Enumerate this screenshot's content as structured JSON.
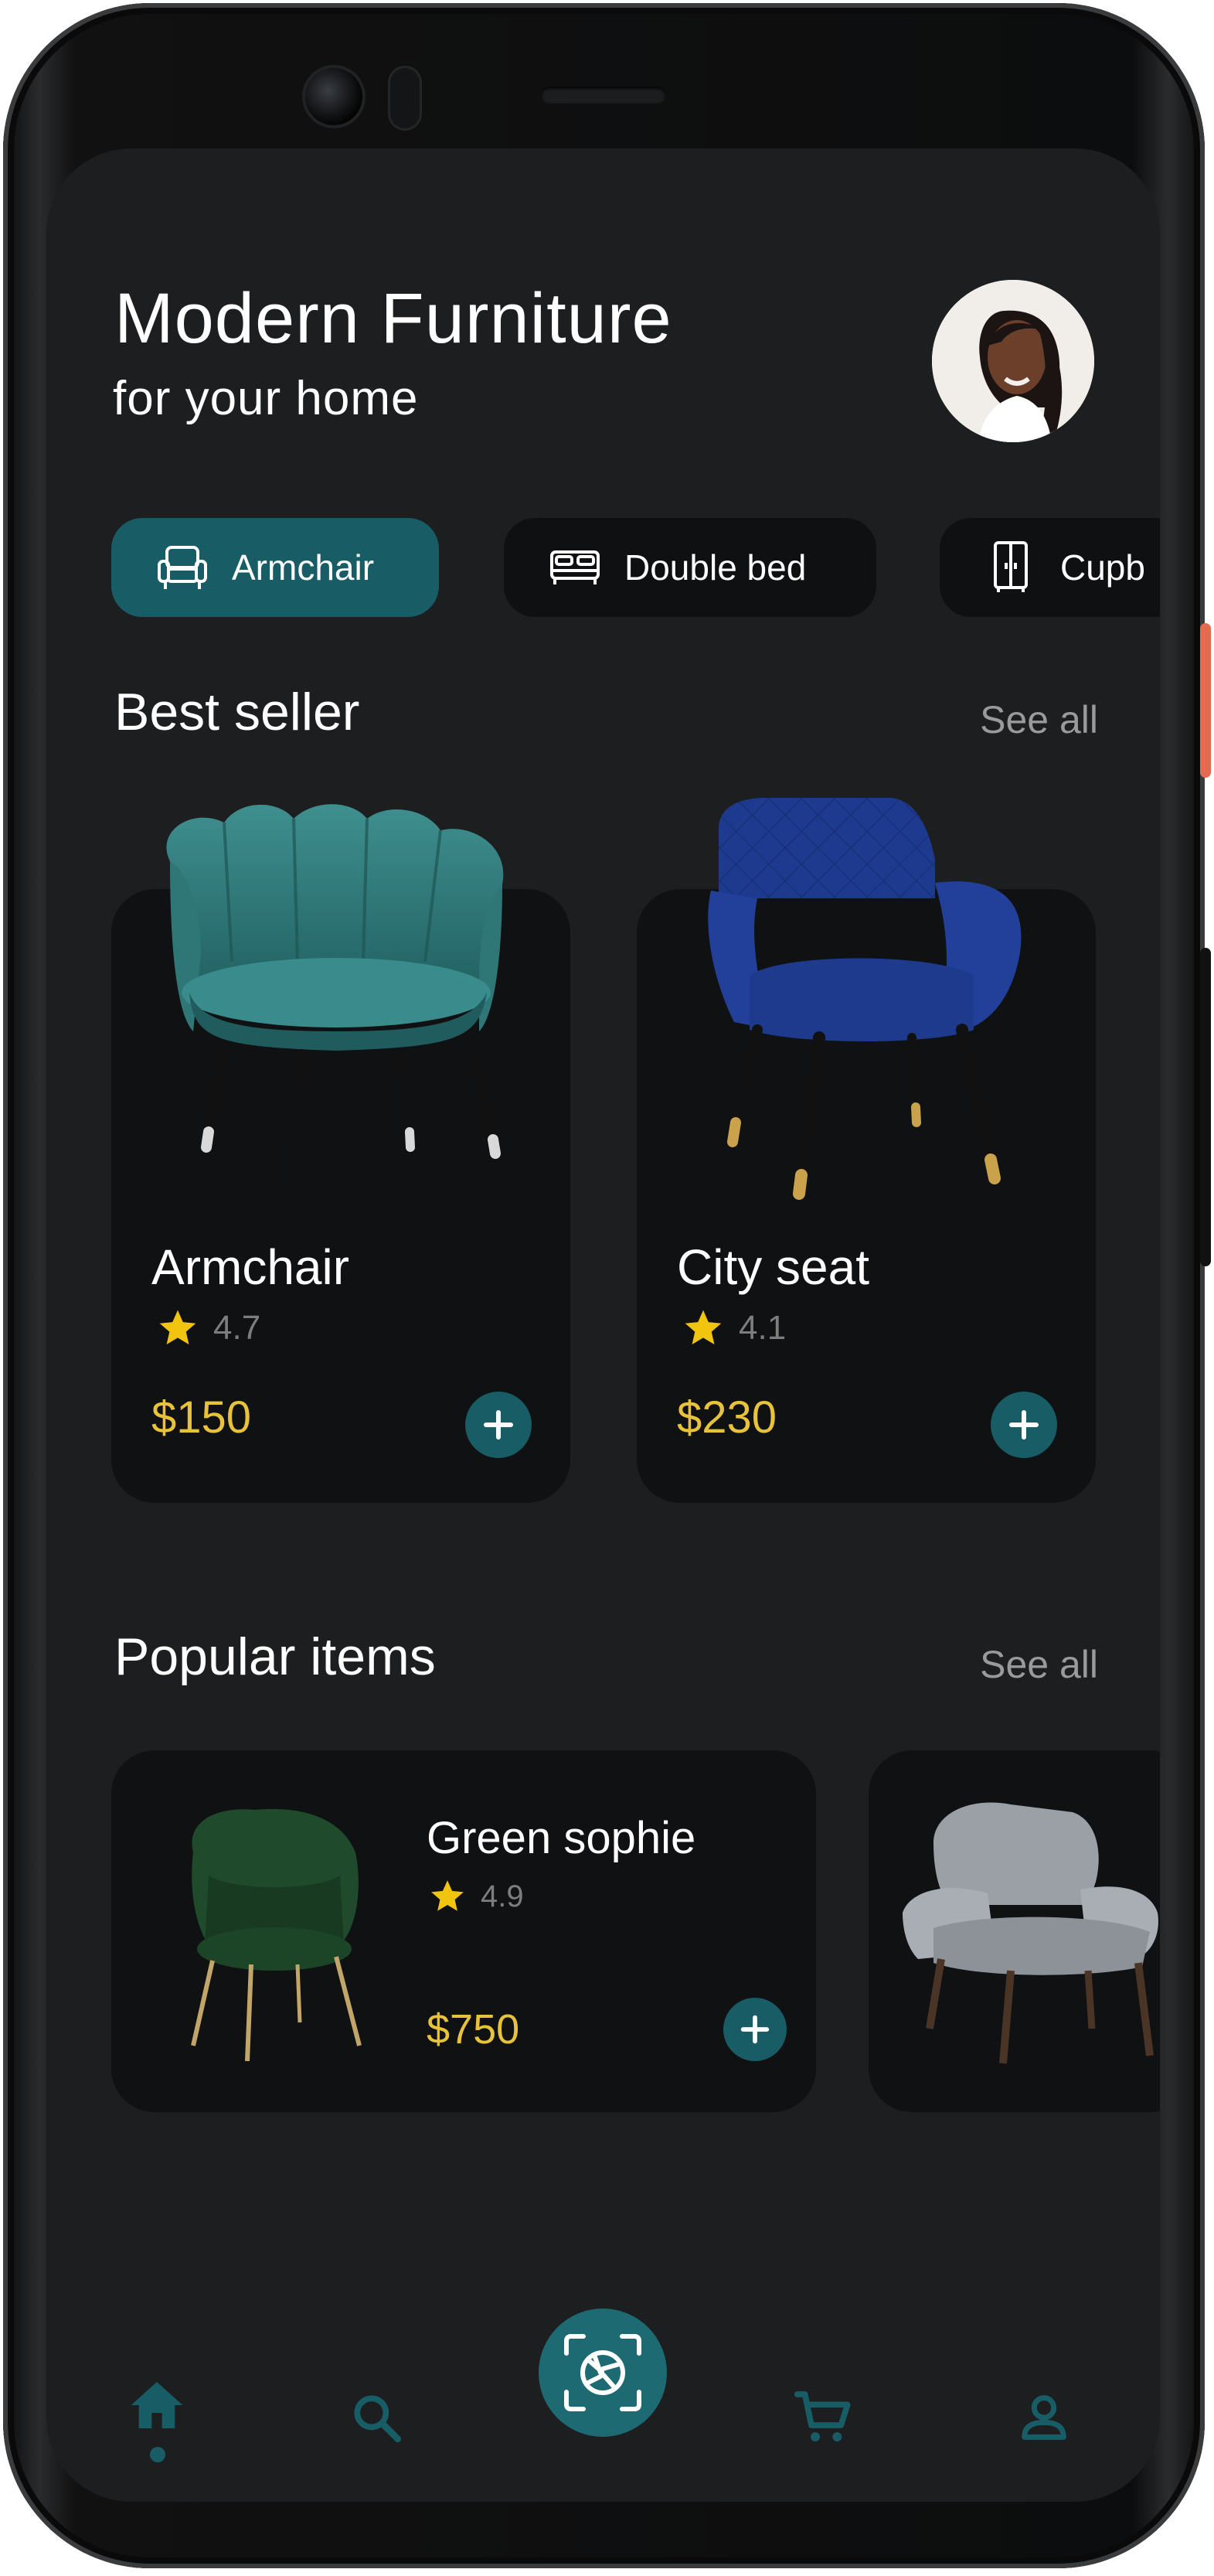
{
  "header": {
    "title": "Modern Furniture",
    "subtitle": "for your home"
  },
  "categories": [
    {
      "label": "Armchair",
      "icon": "armchair-icon",
      "active": true
    },
    {
      "label": "Double bed",
      "icon": "double-bed-icon",
      "active": false
    },
    {
      "label": "Cupb",
      "icon": "cupboard-icon",
      "active": false
    }
  ],
  "best_seller": {
    "title": "Best seller",
    "see_all": "See all",
    "items": [
      {
        "name": "Armchair",
        "rating": "4.7",
        "price": "$150"
      },
      {
        "name": "City seat",
        "rating": "4.1",
        "price": "$230"
      }
    ]
  },
  "popular": {
    "title": "Popular items",
    "see_all": "See all",
    "items": [
      {
        "name": "Green sophie",
        "rating": "4.9",
        "price": "$750"
      }
    ]
  },
  "nav": {
    "items": [
      "home-icon",
      "search-icon",
      "camera-scan-icon",
      "cart-icon",
      "profile-icon"
    ],
    "active": "home-icon"
  },
  "colors": {
    "background": "#1c1e20",
    "card": "#101112",
    "accent": "#185d66",
    "price": "#e7c33c",
    "muted": "#9a9a9a"
  }
}
